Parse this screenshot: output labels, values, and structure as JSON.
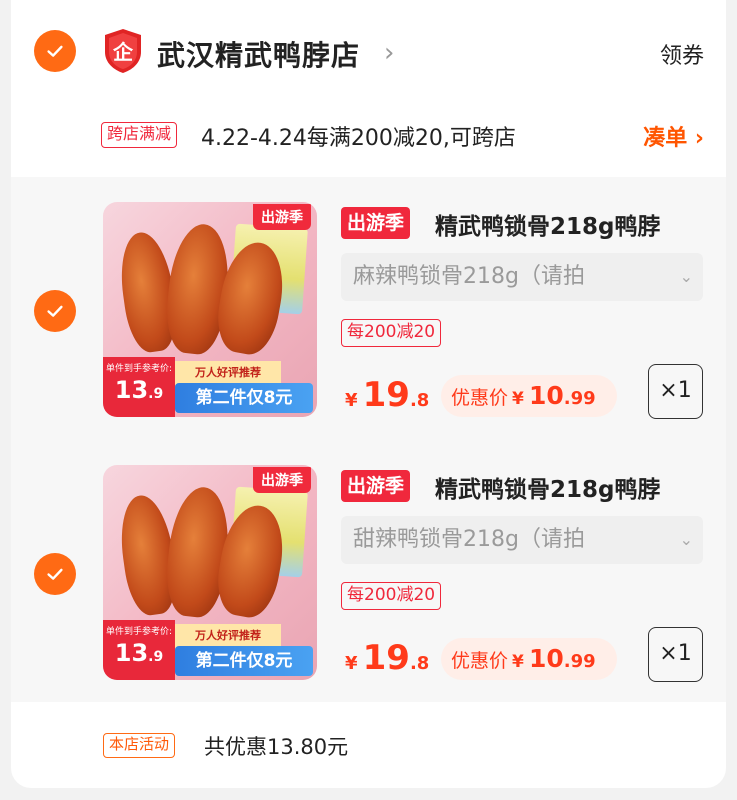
{
  "shop": {
    "logo_char": "企",
    "name": "武汉精武鸭脖店",
    "arrow": "›",
    "coupon_label": "领券"
  },
  "promo": {
    "tag": "跨店满减",
    "text": "4.22-4.24每满200减20,可跨店",
    "link_label": "凑单 ›"
  },
  "items": [
    {
      "thumb": {
        "season": "出游季",
        "price_note": "单件到手参考价:",
        "price_int": "13",
        "price_dec": ".9",
        "review_note": "万人好评推荐",
        "offer": "第二件仅8元"
      },
      "season_tag": "出游季",
      "title": "精武鸭锁骨218g鸭脖",
      "sku": "麻辣鸭锁骨218g（请拍",
      "discount_tag": "每200减20",
      "price": {
        "currency": "¥",
        "int": "19",
        "dec": ".8"
      },
      "deal": {
        "label": "优惠价",
        "currency": "¥",
        "int": "10",
        "dec": ".99"
      },
      "quantity": "×1"
    },
    {
      "thumb": {
        "season": "出游季",
        "price_note": "单件到手参考价:",
        "price_int": "13",
        "price_dec": ".9",
        "review_note": "万人好评推荐",
        "offer": "第二件仅8元"
      },
      "season_tag": "出游季",
      "title": "精武鸭锁骨218g鸭脖",
      "sku": "甜辣鸭锁骨218g（请拍",
      "discount_tag": "每200减20",
      "price": {
        "currency": "¥",
        "int": "19",
        "dec": ".8"
      },
      "deal": {
        "label": "优惠价",
        "currency": "¥",
        "int": "10",
        "dec": ".99"
      },
      "quantity": "×1"
    }
  ],
  "footer": {
    "store_tag": "本店活动",
    "savings": "共优惠13.80元"
  },
  "colors": {
    "accent": "#ff6a14",
    "red": "#f0283c",
    "price": "#ff3a1a"
  }
}
